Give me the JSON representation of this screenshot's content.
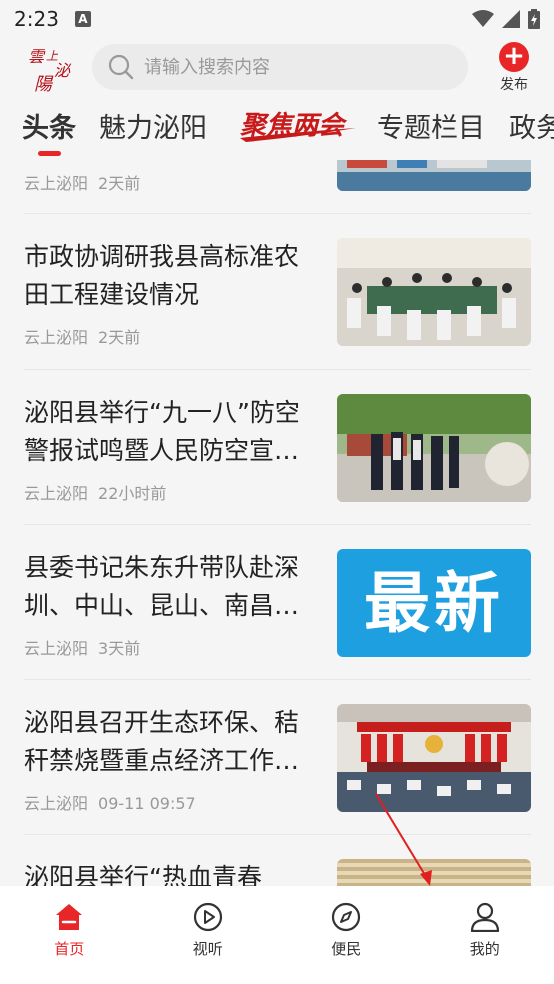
{
  "status_bar": {
    "time": "2:23",
    "app_icon_letter": "A"
  },
  "header": {
    "logo_text": "云上泌阳",
    "search_placeholder": "请输入搜索内容",
    "publish_label": "发布"
  },
  "tabs": [
    {
      "label": "头条",
      "active": true
    },
    {
      "label": "魅力泌阳",
      "active": false
    },
    {
      "label": "聚焦两会",
      "active": false,
      "is_logo": true
    },
    {
      "label": "专题栏目",
      "active": false
    },
    {
      "label": "政务",
      "active": false
    }
  ],
  "news": [
    {
      "title": "",
      "source": "云上泌阳",
      "time": "2天前",
      "thumb": "port"
    },
    {
      "title": "市政协调研我县高标准农田工程建设情况",
      "source": "云上泌阳",
      "time": "2天前",
      "thumb": "meeting"
    },
    {
      "title": "泌阳县举行“九一八”防空警报试鸣暨人民防空宣…",
      "source": "云上泌阳",
      "time": "22小时前",
      "thumb": "street"
    },
    {
      "title": "县委书记朱东升带队赴深圳、中山、昆山、南昌…",
      "source": "云上泌阳",
      "time": "3天前",
      "thumb": "latest",
      "thumb_text": "最新"
    },
    {
      "title": "泌阳县召开生态环保、秸秆禁烧暨重点经济工作…",
      "source": "云上泌阳",
      "time": "09-11 09:57",
      "thumb": "conference"
    },
    {
      "title": "泌阳县举行“热血青春",
      "source": "",
      "time": "",
      "thumb": "hall"
    }
  ],
  "bottom_nav": [
    {
      "label": "首页",
      "icon": "home-icon",
      "active": true
    },
    {
      "label": "视听",
      "icon": "play-icon",
      "active": false
    },
    {
      "label": "便民",
      "icon": "compass-icon",
      "active": false
    },
    {
      "label": "我的",
      "icon": "user-icon",
      "active": false
    }
  ],
  "colors": {
    "accent": "#e82628",
    "background": "#f5f5f5",
    "meta_text": "#999999"
  }
}
